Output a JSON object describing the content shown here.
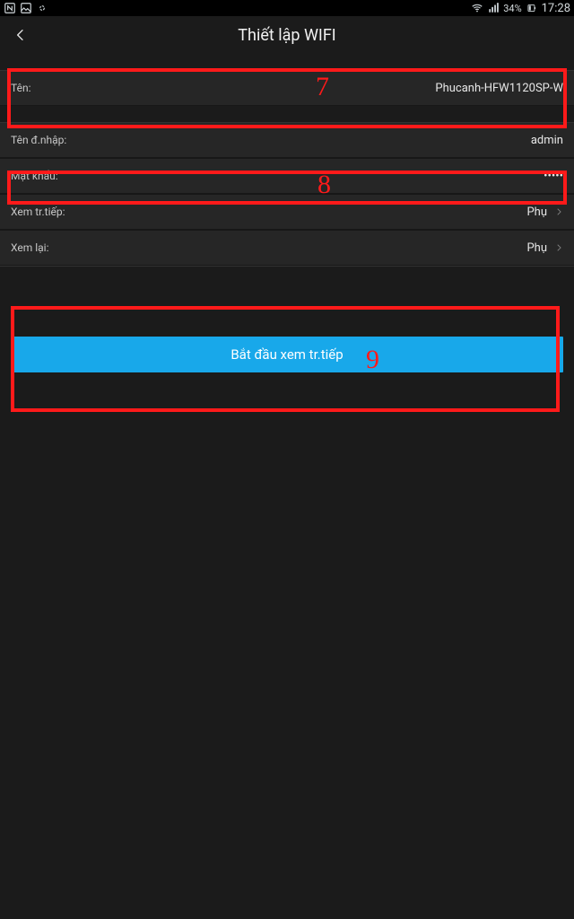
{
  "status": {
    "batteryPct": "34%",
    "time": "17:28"
  },
  "header": {
    "title": "Thiết lập WIFI"
  },
  "rows": {
    "name": {
      "label": "Tên:",
      "value": "Phucanh-HFW1120SP-W"
    },
    "login": {
      "label": "Tên đ.nhập:",
      "value": "admin"
    },
    "password": {
      "label": "Mật khẩu:",
      "value": "•••••"
    },
    "live": {
      "label": "Xem tr.tiếp:",
      "value": "Phụ"
    },
    "replay": {
      "label": "Xem lại:",
      "value": "Phụ"
    }
  },
  "button": {
    "startLiveView": "Bắt đầu xem tr.tiếp"
  },
  "annotations": {
    "a7": "7",
    "a8": "8",
    "a9": "9"
  }
}
